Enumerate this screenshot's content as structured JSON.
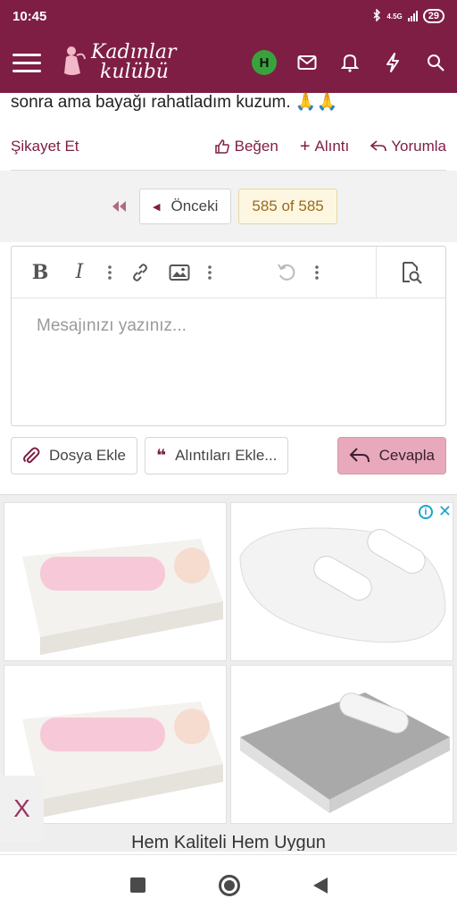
{
  "status": {
    "time": "10:45",
    "network": "4.5G",
    "battery": "29"
  },
  "header": {
    "logo_line1": "Kadınlar",
    "logo_line2": "kulübü",
    "avatar_initial": "H"
  },
  "post": {
    "text_tail": "sonra ama bayağı rahatladım kuzum. 🙏🙏",
    "report_label": "Şikayet Et",
    "like_label": "Beğen",
    "quote_label": "Alıntı",
    "reply_label": "Yorumla"
  },
  "pagination": {
    "prev_label": "Önceki",
    "page_info": "585 of 585"
  },
  "editor": {
    "placeholder": "Mesajınızı yazınız...",
    "attach_label": "Dosya Ekle",
    "insert_quotes_label": "Alıntıları Ekle...",
    "submit_label": "Cevapla"
  },
  "ad": {
    "caption": "Hem Kaliteli Hem Uygun",
    "sticky_close": "X"
  },
  "colors": {
    "brand": "#7e1e44",
    "reply_button": "#e7a9bb",
    "page_badge": "#fdf7e2",
    "avatar": "#38a33c"
  }
}
